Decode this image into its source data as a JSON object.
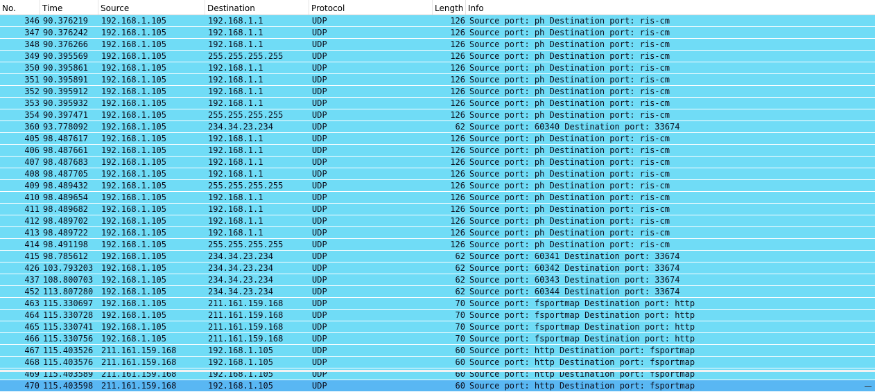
{
  "columns": {
    "no": "No.",
    "time": "Time",
    "source": "Source",
    "destination": "Destination",
    "protocol": "Protocol",
    "length": "Length",
    "info": "Info"
  },
  "colors": {
    "row": "#70dcf6",
    "selected": "#59b7f3"
  },
  "packets": [
    {
      "no": "346",
      "time": "90.376219",
      "src": "192.168.1.105",
      "dst": "192.168.1.1",
      "proto": "UDP",
      "len": "126",
      "info": "Source port: ph  Destination port: ris-cm"
    },
    {
      "no": "347",
      "time": "90.376242",
      "src": "192.168.1.105",
      "dst": "192.168.1.1",
      "proto": "UDP",
      "len": "126",
      "info": "Source port: ph  Destination port: ris-cm"
    },
    {
      "no": "348",
      "time": "90.376266",
      "src": "192.168.1.105",
      "dst": "192.168.1.1",
      "proto": "UDP",
      "len": "126",
      "info": "Source port: ph  Destination port: ris-cm"
    },
    {
      "no": "349",
      "time": "90.395569",
      "src": "192.168.1.105",
      "dst": "255.255.255.255",
      "proto": "UDP",
      "len": "126",
      "info": "Source port: ph  Destination port: ris-cm"
    },
    {
      "no": "350",
      "time": "90.395861",
      "src": "192.168.1.105",
      "dst": "192.168.1.1",
      "proto": "UDP",
      "len": "126",
      "info": "Source port: ph  Destination port: ris-cm"
    },
    {
      "no": "351",
      "time": "90.395891",
      "src": "192.168.1.105",
      "dst": "192.168.1.1",
      "proto": "UDP",
      "len": "126",
      "info": "Source port: ph  Destination port: ris-cm"
    },
    {
      "no": "352",
      "time": "90.395912",
      "src": "192.168.1.105",
      "dst": "192.168.1.1",
      "proto": "UDP",
      "len": "126",
      "info": "Source port: ph  Destination port: ris-cm"
    },
    {
      "no": "353",
      "time": "90.395932",
      "src": "192.168.1.105",
      "dst": "192.168.1.1",
      "proto": "UDP",
      "len": "126",
      "info": "Source port: ph  Destination port: ris-cm"
    },
    {
      "no": "354",
      "time": "90.397471",
      "src": "192.168.1.105",
      "dst": "255.255.255.255",
      "proto": "UDP",
      "len": "126",
      "info": "Source port: ph  Destination port: ris-cm"
    },
    {
      "no": "360",
      "time": "93.778092",
      "src": "192.168.1.105",
      "dst": "234.34.23.234",
      "proto": "UDP",
      "len": "62",
      "info": "Source port: 60340  Destination port: 33674"
    },
    {
      "no": "405",
      "time": "98.487617",
      "src": "192.168.1.105",
      "dst": "192.168.1.1",
      "proto": "UDP",
      "len": "126",
      "info": "Source port: ph  Destination port: ris-cm"
    },
    {
      "no": "406",
      "time": "98.487661",
      "src": "192.168.1.105",
      "dst": "192.168.1.1",
      "proto": "UDP",
      "len": "126",
      "info": "Source port: ph  Destination port: ris-cm"
    },
    {
      "no": "407",
      "time": "98.487683",
      "src": "192.168.1.105",
      "dst": "192.168.1.1",
      "proto": "UDP",
      "len": "126",
      "info": "Source port: ph  Destination port: ris-cm"
    },
    {
      "no": "408",
      "time": "98.487705",
      "src": "192.168.1.105",
      "dst": "192.168.1.1",
      "proto": "UDP",
      "len": "126",
      "info": "Source port: ph  Destination port: ris-cm"
    },
    {
      "no": "409",
      "time": "98.489432",
      "src": "192.168.1.105",
      "dst": "255.255.255.255",
      "proto": "UDP",
      "len": "126",
      "info": "Source port: ph  Destination port: ris-cm"
    },
    {
      "no": "410",
      "time": "98.489654",
      "src": "192.168.1.105",
      "dst": "192.168.1.1",
      "proto": "UDP",
      "len": "126",
      "info": "Source port: ph  Destination port: ris-cm"
    },
    {
      "no": "411",
      "time": "98.489682",
      "src": "192.168.1.105",
      "dst": "192.168.1.1",
      "proto": "UDP",
      "len": "126",
      "info": "Source port: ph  Destination port: ris-cm"
    },
    {
      "no": "412",
      "time": "98.489702",
      "src": "192.168.1.105",
      "dst": "192.168.1.1",
      "proto": "UDP",
      "len": "126",
      "info": "Source port: ph  Destination port: ris-cm"
    },
    {
      "no": "413",
      "time": "98.489722",
      "src": "192.168.1.105",
      "dst": "192.168.1.1",
      "proto": "UDP",
      "len": "126",
      "info": "Source port: ph  Destination port: ris-cm"
    },
    {
      "no": "414",
      "time": "98.491198",
      "src": "192.168.1.105",
      "dst": "255.255.255.255",
      "proto": "UDP",
      "len": "126",
      "info": "Source port: ph  Destination port: ris-cm"
    },
    {
      "no": "415",
      "time": "98.785612",
      "src": "192.168.1.105",
      "dst": "234.34.23.234",
      "proto": "UDP",
      "len": "62",
      "info": "Source port: 60341  Destination port: 33674"
    },
    {
      "no": "426",
      "time": "103.793203",
      "src": "192.168.1.105",
      "dst": "234.34.23.234",
      "proto": "UDP",
      "len": "62",
      "info": "Source port: 60342  Destination port: 33674"
    },
    {
      "no": "437",
      "time": "108.800703",
      "src": "192.168.1.105",
      "dst": "234.34.23.234",
      "proto": "UDP",
      "len": "62",
      "info": "Source port: 60343  Destination port: 33674"
    },
    {
      "no": "452",
      "time": "113.807280",
      "src": "192.168.1.105",
      "dst": "234.34.23.234",
      "proto": "UDP",
      "len": "62",
      "info": "Source port: 60344  Destination port: 33674"
    },
    {
      "no": "463",
      "time": "115.330697",
      "src": "192.168.1.105",
      "dst": "211.161.159.168",
      "proto": "UDP",
      "len": "70",
      "info": "Source port: fsportmap  Destination port: http"
    },
    {
      "no": "464",
      "time": "115.330728",
      "src": "192.168.1.105",
      "dst": "211.161.159.168",
      "proto": "UDP",
      "len": "70",
      "info": "Source port: fsportmap  Destination port: http"
    },
    {
      "no": "465",
      "time": "115.330741",
      "src": "192.168.1.105",
      "dst": "211.161.159.168",
      "proto": "UDP",
      "len": "70",
      "info": "Source port: fsportmap  Destination port: http"
    },
    {
      "no": "466",
      "time": "115.330756",
      "src": "192.168.1.105",
      "dst": "211.161.159.168",
      "proto": "UDP",
      "len": "70",
      "info": "Source port: fsportmap  Destination port: http"
    },
    {
      "no": "467",
      "time": "115.403526",
      "src": "211.161.159.168",
      "dst": "192.168.1.105",
      "proto": "UDP",
      "len": "60",
      "info": "Source port: http  Destination port: fsportmap"
    },
    {
      "no": "468",
      "time": "115.403576",
      "src": "211.161.159.168",
      "dst": "192.168.1.105",
      "proto": "UDP",
      "len": "60",
      "info": "Source port: http  Destination port: fsportmap"
    },
    {
      "no": "469",
      "time": "115.403589",
      "src": "211.161.159.168",
      "dst": "192.168.1.105",
      "proto": "UDP",
      "len": "60",
      "info": "Source port: http  Destination port: fsportmap"
    },
    {
      "no": "470",
      "time": "115.403598",
      "src": "211.161.159.168",
      "dst": "192.168.1.105",
      "proto": "UDP",
      "len": "60",
      "info": "Source port: http  Destination port: fsportmap",
      "selected": true
    }
  ]
}
